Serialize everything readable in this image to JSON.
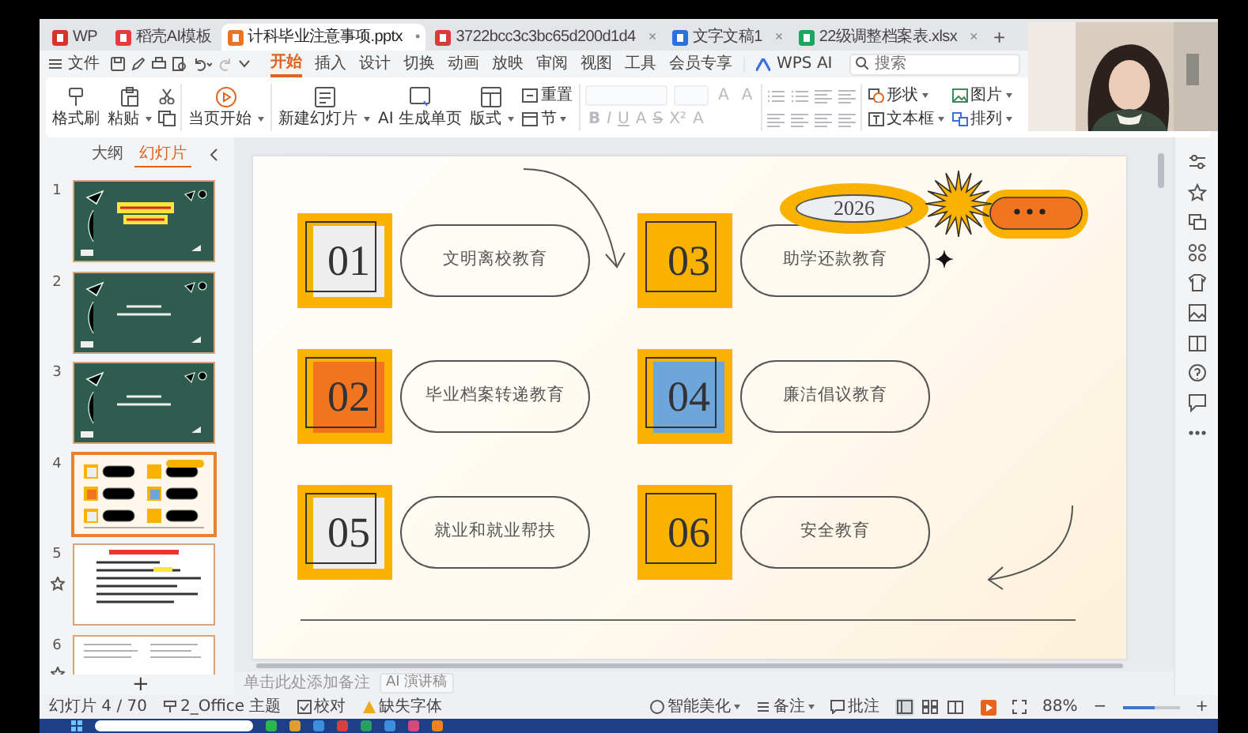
{
  "tabs": [
    {
      "label": "WP",
      "kind": "wps",
      "selected": false
    },
    {
      "label": "稻壳AI模板",
      "kind": "docer",
      "selected": false
    },
    {
      "label": "计科毕业注意事项.pptx",
      "kind": "pptx",
      "selected": true,
      "end_mark": "•"
    },
    {
      "label": "3722bcc3c3bc65d200d1d4",
      "kind": "pdf",
      "selected": false,
      "end_mark": "×"
    },
    {
      "label": "文字文稿1",
      "kind": "doc",
      "selected": false,
      "end_mark": "×"
    },
    {
      "label": "22级调整档案表.xlsx",
      "kind": "xlsx",
      "selected": false,
      "end_mark": "×"
    }
  ],
  "new_tab": "+",
  "menu": {
    "file": "文件",
    "tabs": [
      {
        "label": "开始",
        "selected": true
      },
      {
        "label": "插入",
        "selected": false
      },
      {
        "label": "设计",
        "selected": false
      },
      {
        "label": "切换",
        "selected": false
      },
      {
        "label": "动画",
        "selected": false
      },
      {
        "label": "放映",
        "selected": false
      },
      {
        "label": "审阅",
        "selected": false
      },
      {
        "label": "视图",
        "selected": false
      },
      {
        "label": "工具",
        "selected": false
      },
      {
        "label": "会员专享",
        "selected": false
      }
    ],
    "ai": "WPS AI",
    "search_placeholder": "搜索"
  },
  "ribbon": {
    "format_painter": "格式刷",
    "paste": "粘贴",
    "start_from_current": "当页开始",
    "new_slide": "新建幻灯片",
    "ai_page": "AI 生成单页",
    "layout": "版式",
    "reset": "重置",
    "section": "节",
    "font_top": [
      {
        "label": "A"
      },
      {
        "label": "A"
      }
    ],
    "font_buttons": [
      {
        "label": "B"
      },
      {
        "label": "I"
      },
      {
        "label": "U"
      },
      {
        "label": "A"
      },
      {
        "label": "S"
      },
      {
        "label": "X²"
      },
      {
        "label": "A"
      }
    ],
    "shape": "形状",
    "picture": "图片",
    "textbox": "文本框",
    "arrange": "排列"
  },
  "panel_tabs": [
    {
      "label": "大纲",
      "selected": false
    },
    {
      "label": "幻灯片",
      "selected": true
    }
  ],
  "slides": [
    {
      "number": "1",
      "kind": "title",
      "selected": false,
      "animated": false
    },
    {
      "number": "2",
      "kind": "chalkboard",
      "selected": false,
      "animated": false
    },
    {
      "number": "3",
      "kind": "chalkboard",
      "selected": false,
      "animated": false
    },
    {
      "number": "4",
      "kind": "items",
      "selected": true,
      "animated": false
    },
    {
      "number": "5",
      "kind": "document",
      "selected": false,
      "animated": true
    },
    {
      "number": "6",
      "kind": "table",
      "selected": false,
      "animated": true
    }
  ],
  "add_slide": "+",
  "slide": {
    "badge": "2026",
    "items": [
      {
        "number": "01",
        "label": "文明离校教育",
        "color": "#eeeeee"
      },
      {
        "number": "03",
        "label": "助学还款教育"
      },
      {
        "number": "02",
        "label": "毕业档案转递教育",
        "color": "#f27420"
      },
      {
        "number": "04",
        "label": "廉洁倡议教育",
        "color": "#6ea6dc"
      },
      {
        "number": "05",
        "label": "就业和就业帮扶",
        "color": "#eeeeee"
      },
      {
        "number": "06",
        "label": "安全教育"
      }
    ]
  },
  "notes_placeholder": "单击此处添加备注",
  "ai_speech": "AI 演讲稿",
  "status": {
    "slide_counter": "幻灯片 4 / 70",
    "theme": "2_Office 主题",
    "proofing": "校对",
    "missing_fonts": "缺失字体",
    "beautify": "智能美化",
    "notes": "备注",
    "comments": "批注",
    "views": [
      {
        "kind": "normal",
        "selected": true
      },
      {
        "kind": "sorter",
        "selected": false
      },
      {
        "kind": "reading",
        "selected": false
      }
    ],
    "zoom": "88%",
    "zoom_out": "−",
    "zoom_in": "+",
    "zoom_slider": {
      "level": 0.57
    }
  }
}
